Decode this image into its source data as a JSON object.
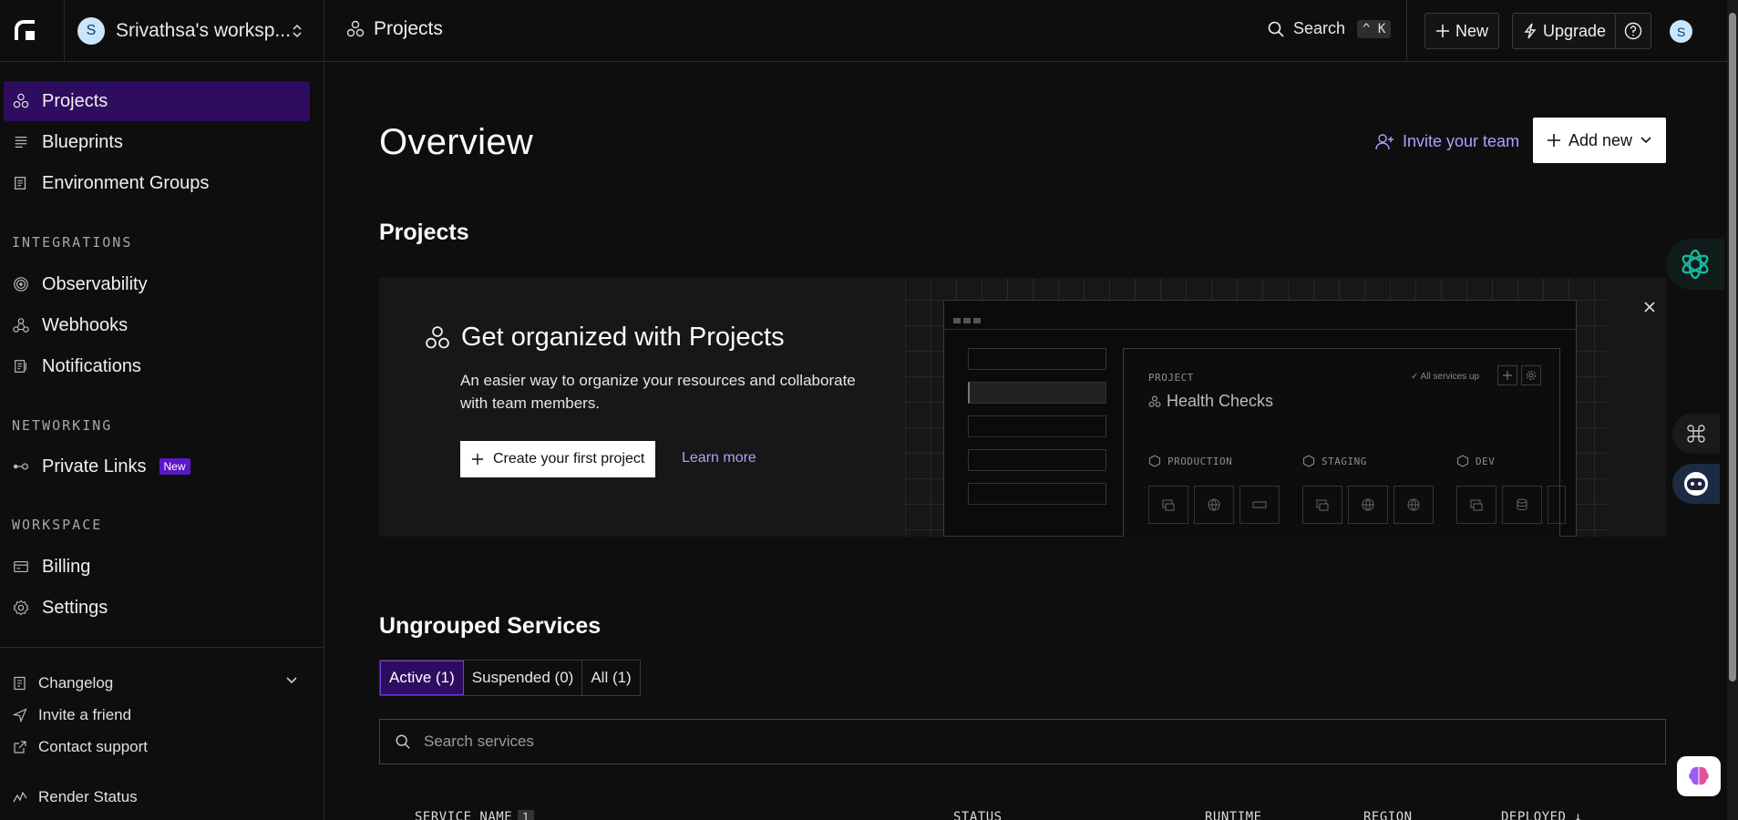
{
  "topbar": {
    "workspace_initial": "S",
    "workspace_name": "Srivathsa's worksp...",
    "breadcrumb": "Projects",
    "search_label": "Search",
    "search_shortcut_mod": "^",
    "search_shortcut_key": "K",
    "new_label": "New",
    "upgrade_label": "Upgrade",
    "user_initial": "S"
  },
  "sidebar": {
    "items": [
      {
        "label": "Projects",
        "icon": "projects-icon",
        "active": true
      },
      {
        "label": "Blueprints",
        "icon": "blueprints-icon"
      },
      {
        "label": "Environment Groups",
        "icon": "env-groups-icon"
      }
    ],
    "integrations_heading": "INTEGRATIONS",
    "integrations": [
      {
        "label": "Observability",
        "icon": "observability-icon"
      },
      {
        "label": "Webhooks",
        "icon": "webhooks-icon"
      },
      {
        "label": "Notifications",
        "icon": "notifications-icon"
      }
    ],
    "networking_heading": "NETWORKING",
    "networking": [
      {
        "label": "Private Links",
        "icon": "private-links-icon",
        "badge": "New"
      }
    ],
    "workspace_heading": "WORKSPACE",
    "workspace": [
      {
        "label": "Billing",
        "icon": "billing-icon"
      },
      {
        "label": "Settings",
        "icon": "settings-icon"
      }
    ],
    "footer": [
      {
        "label": "Changelog",
        "icon": "changelog-icon"
      },
      {
        "label": "Invite a friend",
        "icon": "send-icon"
      },
      {
        "label": "Contact support",
        "icon": "external-link-icon"
      },
      {
        "label": "Render Status",
        "icon": "status-icon"
      }
    ]
  },
  "main": {
    "title": "Overview",
    "invite_team": "Invite your team",
    "add_new": "Add new",
    "projects_heading": "Projects",
    "promo": {
      "title": "Get organized with Projects",
      "description": "An easier way to organize your resources and collaborate with team members.",
      "create_button": "Create your first project",
      "learn_more": "Learn more",
      "mock": {
        "label": "PROJECT",
        "project_name": "Health Checks",
        "status": "All services up",
        "envs": [
          "PRODUCTION",
          "STAGING",
          "DEV"
        ]
      }
    },
    "services_heading": "Ungrouped Services",
    "tabs": [
      {
        "label": "Active (1)",
        "active": true
      },
      {
        "label": "Suspended (0)"
      },
      {
        "label": "All (1)"
      }
    ],
    "search_placeholder": "Search services",
    "table_headers": {
      "name": "SERVICE NAME",
      "name_count": "1",
      "status": "STATUS",
      "runtime": "RUNTIME",
      "region": "REGION",
      "deployed": "DEPLOYED"
    }
  },
  "colors": {
    "accent_purple": "#2e0c60",
    "link_purple": "#b69bff",
    "badge_purple": "#5b18c7",
    "background": "#0e0e0e"
  }
}
